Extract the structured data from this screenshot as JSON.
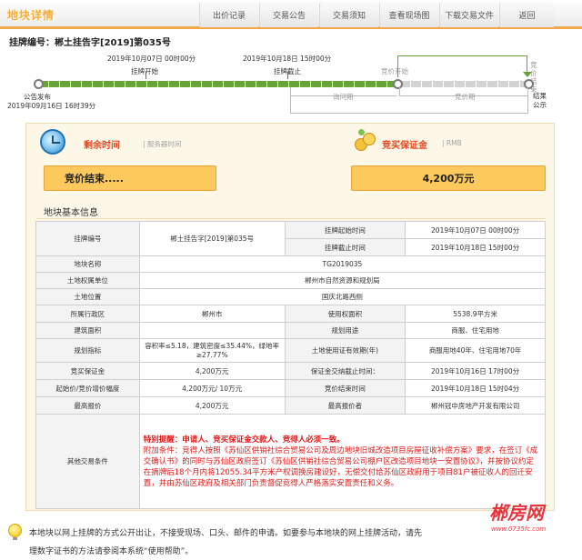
{
  "header": {
    "logo": "地块详情",
    "tabs": [
      "出价记录",
      "交易公告",
      "交易须知",
      "查看现场图",
      "下载交易文件",
      "返回"
    ]
  },
  "listing": {
    "code_label": "挂牌编号：",
    "code_value": "郴土挂告字[2019]第035号"
  },
  "timeline": {
    "start_label": "挂牌开始",
    "start_date": "2019年10月07日 00时00分",
    "end_label": "挂牌截止",
    "end_date": "2019年10月18日 15时00分",
    "publish_label": "公告发布",
    "publish_date": "2019年09月16日 16时39分",
    "bid_start_label": "竞价开始",
    "bid_end_label": "竞价结束",
    "inquiry_label": "询问期",
    "bidding_label": "竞价期",
    "result_label": "结果公示"
  },
  "countdown": {
    "title": "剩余时间",
    "subtitle": "| 服务器时间",
    "value": "竞价结束....."
  },
  "deposit": {
    "title": "竞买保证金",
    "subtitle": "| RMB",
    "value": "4,200万元"
  },
  "section_title": "地块基本信息",
  "info": {
    "code_k": "挂牌编号",
    "code_v": "郴土挂告字[2019]第035号",
    "start_k": "挂牌起始时间",
    "start_v": "2019年10月07日 00时00分",
    "end_k": "挂牌截止时间",
    "end_v": "2019年10月18日 15时00分",
    "name_k": "地块名称",
    "name_v": "TG2019035",
    "owner_k": "土地权属单位",
    "owner_v": "郴州市自然资源和规划局",
    "loc_k": "土地位置",
    "loc_v": "国庆北路西侧",
    "district_k": "所属行政区",
    "district_v": "郴州市",
    "area_k": "使用权面积",
    "area_v": "5538.9平方米",
    "build_k": "建筑面积",
    "build_v": "",
    "use_k": "规划用途",
    "use_v": "商服、住宅用地",
    "index_k": "规划指标",
    "index_v": "容积率≤5.18，建筑密度≤35.44%，绿地率≥27.77%",
    "term_k": "土地使用证有效期(年)",
    "term_v": "商服用地40年、住宅用地70年",
    "deposit_k": "竞买保证金",
    "deposit_v": "4,200万元",
    "deadline_k": "保证金交纳截止时间：",
    "deadline_v": "2019年10月16日 17时00分",
    "price_k": "起始价/竞价增价幅度",
    "price_v": "4,200万元/ 10万元",
    "bid_end_k": "竞价结束时间",
    "bid_end_v": "2019年10月18日 15时04分",
    "top_k": "最高报价",
    "top_v": "4,200万元",
    "bidder_k": "最高报价者",
    "bidder_v": "郴州冠中房地产开发有限公司",
    "other_k": "其他交易条件",
    "other_alert": "特别提醒：申请人、竞买保证金交款人、竞得人必须一致。",
    "other_text": "附加条件：竞得人按照《苏仙区供销社综合贸易公司及周边地块旧城改造项目房屋征收补偿方案》要求，在签订《成交确认书》的同时与苏仙区政府签订《苏仙区供销社综合贸易公司棚户区改造项目地块一安置协议》，并按协议约定在摘牌后18个月内将12055.34平方米产权调换房建设好，无偿交付给苏仙区政府用于项目81户被征收人的回迁安置，并由苏仙区政府及相关部门负责督促竞得人严格落实安置责任和义务。"
  },
  "footer": {
    "text_a": "本地块以网上挂牌的方式公开出让，不接受现场、口头、邮件的申请。如要参与本地块的网上挂牌活动，请先",
    "text_b": "理数字证书的方法请参阅本系统“使用帮助”。"
  },
  "brand": {
    "name": "郴房网",
    "url": "www.0735fc.com"
  },
  "colors": {
    "accent": "#f0a848",
    "alert": "#e01818",
    "track": "#69a33a"
  }
}
